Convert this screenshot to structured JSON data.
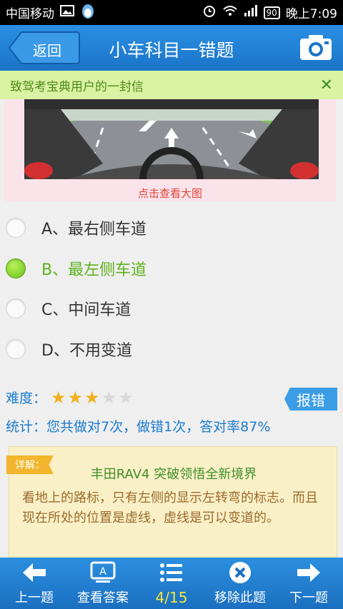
{
  "status": {
    "carrier": "中国移动",
    "battery": "90",
    "time": "晚上7:09"
  },
  "header": {
    "back_label": "返回",
    "title": "小车科目一错题"
  },
  "notice": {
    "text": "致驾考宝典用户的一封信",
    "close": "✕"
  },
  "image_card": {
    "caption": "点击查看大图"
  },
  "options": [
    {
      "label": "A、最右侧车道",
      "selected": false
    },
    {
      "label": "B、最左侧车道",
      "selected": true
    },
    {
      "label": "C、中间车道",
      "selected": false
    },
    {
      "label": "D、不用变道",
      "selected": false
    }
  ],
  "difficulty": {
    "label": "难度：",
    "stars_filled": 3,
    "stars_total": 5
  },
  "report_label": "报错",
  "stats_text": "统计：您共做对7次，做错1次，答对率87%",
  "detail": {
    "tag": "详解：",
    "title": "丰田RAV4 突破领悟全新境界",
    "body": "看地上的路标，只有左侧的显示左转弯的标志。而且现在所处的位置是虚线，虚线是可以变道的。"
  },
  "bottom_nav": {
    "prev": "上一题",
    "answer": "查看答案",
    "page": "4/15",
    "remove": "移除此题",
    "next": "下一题"
  },
  "colors": {
    "accent": "#1a7bd0",
    "selected": "#5cb31b",
    "notice_bg": "#d9f2a3",
    "detail_bg": "#faf0c8"
  }
}
